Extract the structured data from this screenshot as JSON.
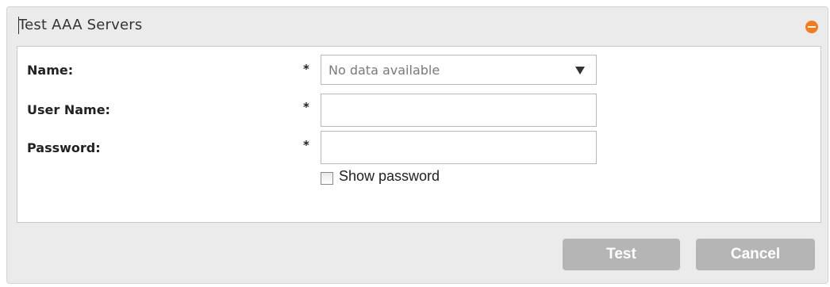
{
  "dialog": {
    "title": "Test AAA Servers"
  },
  "form": {
    "name": {
      "label": "Name:",
      "required_mark": "*",
      "selected_value": "No data available"
    },
    "user_name": {
      "label": "User Name:",
      "required_mark": "*",
      "value": ""
    },
    "password": {
      "label": "Password:",
      "required_mark": "*",
      "value": ""
    },
    "show_password": {
      "label": "Show password",
      "checked": false
    }
  },
  "buttons": {
    "test": "Test",
    "cancel": "Cancel"
  },
  "colors": {
    "collapse_icon": "#f47b20",
    "button_bg": "#b5b5b5",
    "dialog_bg": "#ebebeb"
  },
  "icons": {
    "collapse": "minus-circle-icon",
    "dropdown": "caret-down-icon"
  }
}
